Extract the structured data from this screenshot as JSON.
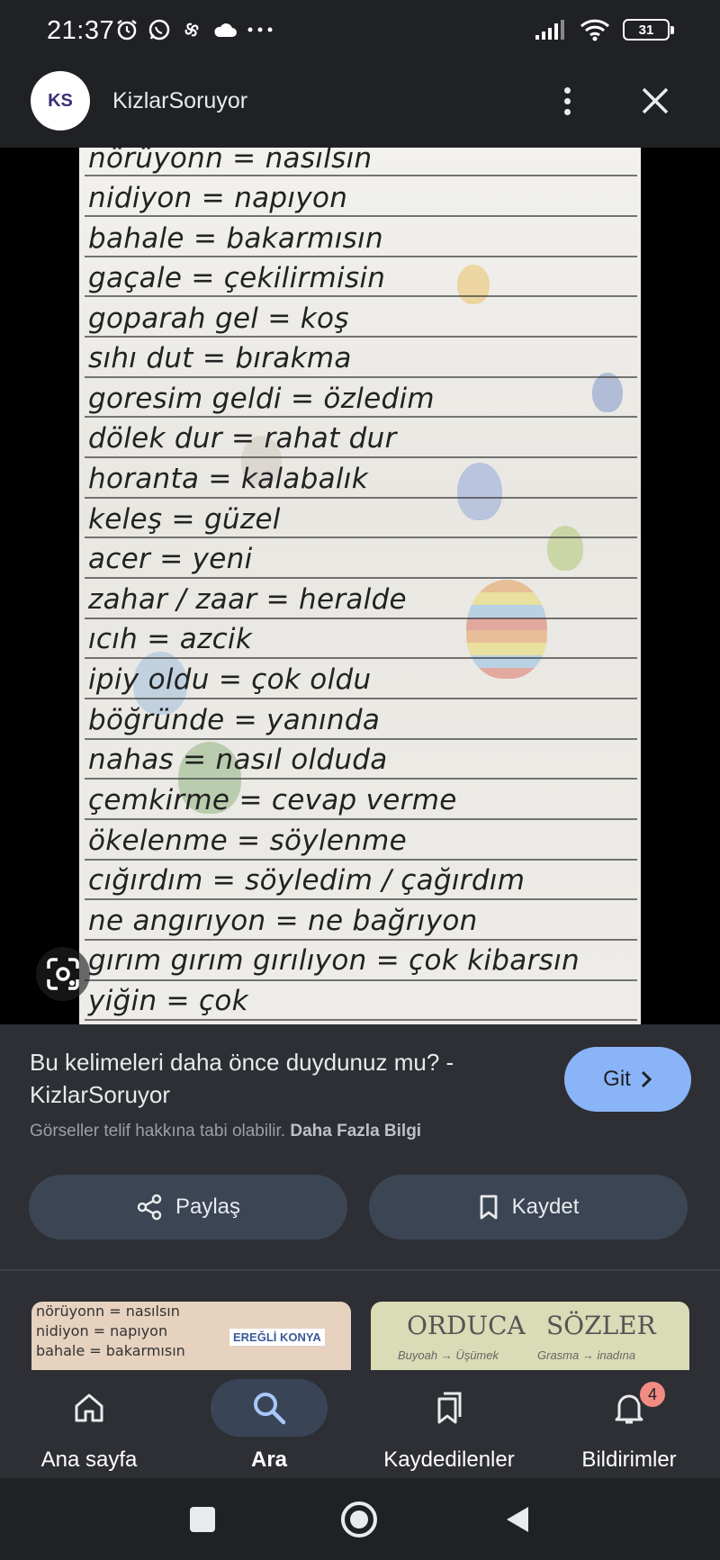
{
  "status_bar": {
    "time": "21:37",
    "battery": "31"
  },
  "header": {
    "logo_text": "KS",
    "site_name": "KizlarSoruyor"
  },
  "image": {
    "lines": [
      "nörüyonn = nasılsın",
      "nidiyon = napıyon",
      "bahale = bakarmısın",
      "gaçale = çekilirmisin",
      "goparah gel = koş",
      "sıhı dut = bırakma",
      "goresim geldi = özledim",
      "dölek dur = rahat dur",
      "horanta = kalabalık",
      "keleş = güzel",
      "acer = yeni",
      "zahar / zaar = heralde",
      "ıcıh = azcik",
      "ipiy oldu = çok oldu",
      "böğründe = yanında",
      "nahas = nasıl olduda",
      "çemkirme = cevap verme",
      "ökelenme = söylenme",
      "cığırdım = söyledim / çağırdım",
      "ne angırıyon = ne bağrıyon",
      "gırım gırım gırılıyon = çok kibarsın",
      "yiğin = çok"
    ]
  },
  "info": {
    "title": "Bu kelimeleri daha önce duydunuz mu? - KizlarSoruyor",
    "go_label": "Git",
    "copyright": "Görseller telif hakkına tabi olabilir.",
    "more_info": "Daha Fazla Bilgi",
    "share_label": "Paylaş",
    "save_label": "Kaydet"
  },
  "related": {
    "thumb1": {
      "lines": [
        "nörüyonn = nasılsın",
        "nidiyon = napıyon",
        "bahale = bakarmısın"
      ],
      "badge": "EREĞLİ KONYA"
    },
    "thumb2": {
      "left_heading": "ORDUCA",
      "right_heading": "SÖZLER",
      "left_sub": "Buyoah → Üşümek",
      "right_sub": "Grasma → inadına"
    }
  },
  "bottom_nav": {
    "items": [
      {
        "label": "Ana sayfa",
        "icon": "home-icon"
      },
      {
        "label": "Ara",
        "icon": "search-icon"
      },
      {
        "label": "Kaydedilenler",
        "icon": "bookmarks-icon"
      },
      {
        "label": "Bildirimler",
        "icon": "bell-icon"
      }
    ],
    "notif_count": "4",
    "active": "Ara"
  }
}
